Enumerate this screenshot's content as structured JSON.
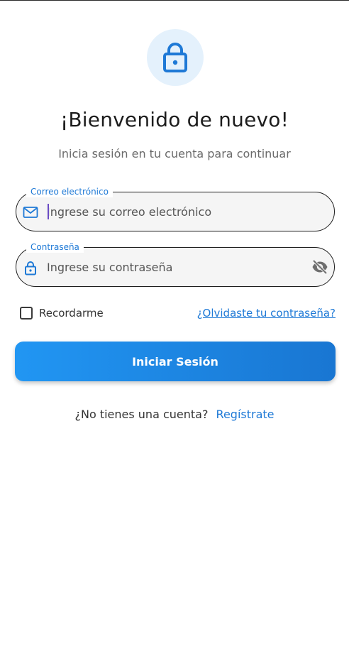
{
  "header": {
    "title": "¡Bienvenido de nuevo!",
    "subtitle": "Inicia sesión en tu cuenta para continuar",
    "icon": "lock-icon",
    "icon_bg_color": "#e4f1fc",
    "icon_color": "#1e79d6"
  },
  "form": {
    "email": {
      "label": "Correo electrónico",
      "placeholder": "Ingrese su correo electrónico",
      "value": "",
      "icon": "mail-icon"
    },
    "password": {
      "label": "Contraseña",
      "placeholder": "Ingrese su contraseña",
      "value": "",
      "icon": "lock-icon",
      "toggle_icon": "eye-off-icon"
    },
    "remember_label": "Recordarme",
    "remember_checked": false,
    "forgot_label": "¿Olvidaste tu contraseña?",
    "submit_label": "Iniciar Sesión"
  },
  "signup": {
    "prompt": "¿No tienes una cuenta?",
    "link_label": "Regístrate"
  },
  "colors": {
    "accent": "#1e79d6",
    "button_gradient_start": "#2196f3",
    "button_gradient_end": "#1976d2"
  }
}
